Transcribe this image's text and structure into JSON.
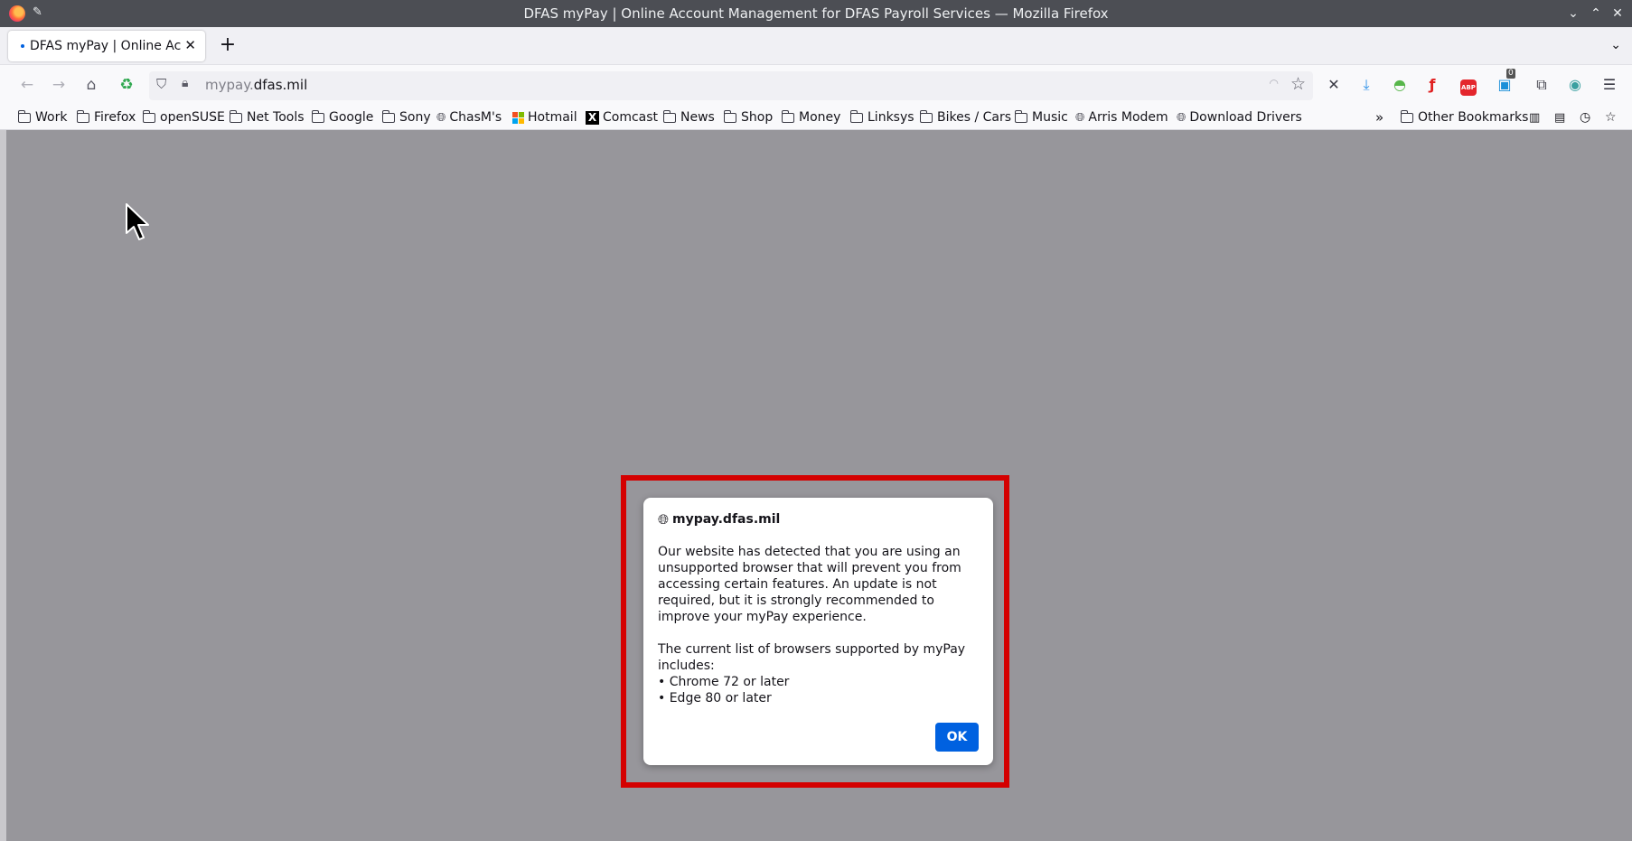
{
  "window": {
    "title": "DFAS myPay | Online Account Management for DFAS Payroll Services — Mozilla Firefox"
  },
  "tabs": [
    {
      "label": "DFAS myPay | Online Acco"
    }
  ],
  "urlbar": {
    "host_prefix": "mypay.",
    "host_main": "dfas.mil"
  },
  "bookmarks": {
    "items": [
      {
        "label": "Work",
        "icon": "folder-icon"
      },
      {
        "label": "Firefox",
        "icon": "folder-icon"
      },
      {
        "label": "openSUSE",
        "icon": "folder-icon"
      },
      {
        "label": "Net Tools",
        "icon": "folder-icon"
      },
      {
        "label": "Google",
        "icon": "folder-icon"
      },
      {
        "label": "Sony",
        "icon": "folder-icon"
      },
      {
        "label": "ChasM's",
        "icon": "globe-icon"
      },
      {
        "label": "Hotmail",
        "icon": "microsoft-icon"
      },
      {
        "label": "Comcast",
        "icon": "x-icon"
      },
      {
        "label": "News",
        "icon": "folder-icon"
      },
      {
        "label": "Shop",
        "icon": "folder-icon"
      },
      {
        "label": "Money",
        "icon": "folder-icon"
      },
      {
        "label": "Linksys",
        "icon": "folder-icon"
      },
      {
        "label": "Bikes / Cars",
        "icon": "folder-icon"
      },
      {
        "label": "Music",
        "icon": "folder-icon"
      },
      {
        "label": "Arris Modem",
        "icon": "globe-icon"
      },
      {
        "label": "Download Drivers",
        "icon": "globe-icon"
      }
    ],
    "other": "Other Bookmarks"
  },
  "toolbar": {
    "badge_count": "0"
  },
  "dialog": {
    "origin": "mypay.dfas.mil",
    "message": "Our website has detected that you are using an unsupported browser that will prevent you from accessing certain features. An update is not required, but it is strongly recommended to improve your myPay experience.",
    "list_intro": "The current list of browsers supported by myPay includes:",
    "list": [
      "• Chrome 72 or later",
      "• Edge 80 or later"
    ],
    "ok_label": "OK"
  },
  "colors": {
    "highlight_border": "#d40000",
    "accent": "#0061e0",
    "overlay": "#97969b"
  }
}
